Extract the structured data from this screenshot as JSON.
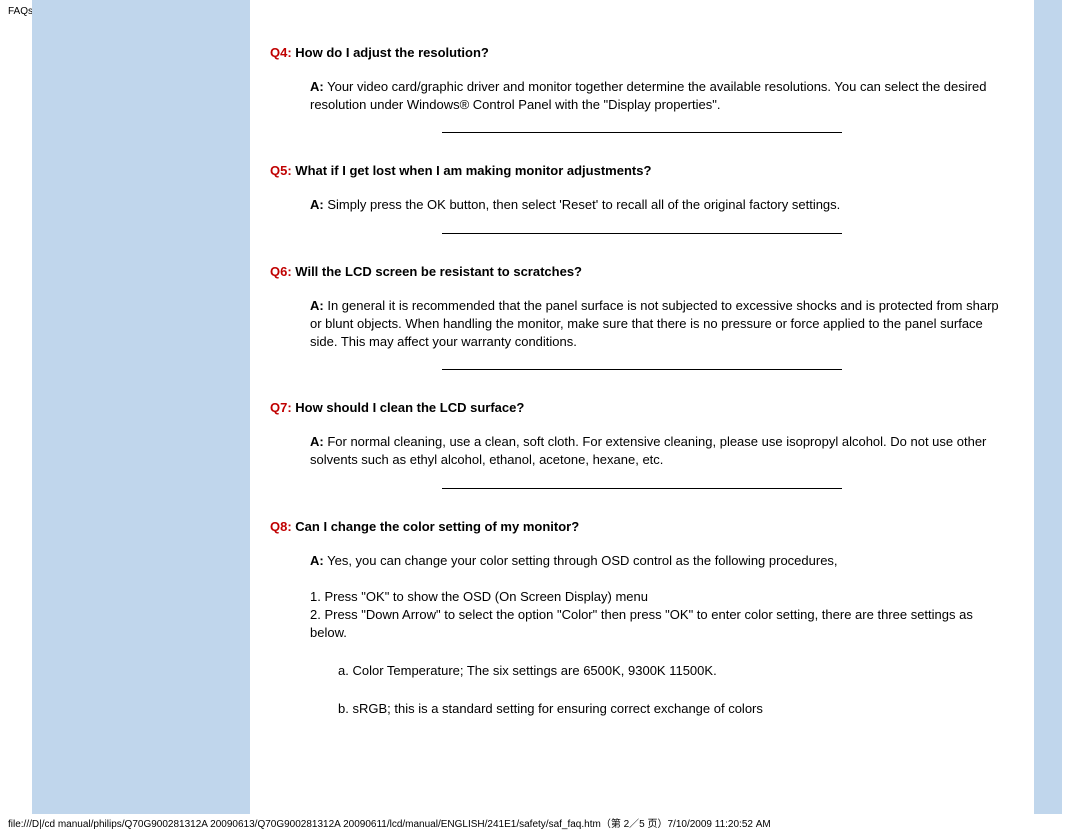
{
  "header": {
    "title": "FAQs (Frequently Asked Questions)"
  },
  "faqs": {
    "q4": {
      "label": "Q4:",
      "question": "How do I adjust the resolution?",
      "a_label": "A:",
      "answer": "Your video card/graphic driver and monitor together determine the available resolutions. You can select the desired resolution under Windows® Control Panel with the \"Display properties\"."
    },
    "q5": {
      "label": "Q5:",
      "question": "What if I get lost when I am making monitor adjustments?",
      "a_label": "A:",
      "answer": "Simply press the OK button, then select 'Reset' to recall all of the original factory settings."
    },
    "q6": {
      "label": "Q6:",
      "question": "Will the LCD screen be resistant to scratches?",
      "a_label": "A:",
      "answer": "In general it is recommended that the panel surface is not subjected to excessive shocks and is protected from sharp or blunt objects. When handling the monitor, make sure that there is no pressure or force applied to the panel surface side. This may affect your warranty conditions."
    },
    "q7": {
      "label": "Q7:",
      "question": "How should I clean the LCD surface?",
      "a_label": "A:",
      "answer": "For normal cleaning, use a clean, soft cloth. For extensive cleaning, please use isopropyl alcohol. Do not use other solvents such as ethyl alcohol, ethanol, acetone, hexane, etc."
    },
    "q8": {
      "label": "Q8:",
      "question": "Can I change the color setting of my monitor?",
      "a_label": "A:",
      "answer": "Yes, you can change your color setting through OSD control as the following procedures,",
      "step1": "1. Press \"OK\" to show the OSD (On Screen Display) menu",
      "step2": "2. Press \"Down Arrow\" to select the option \"Color\" then press \"OK\" to enter color setting, there are three settings as below.",
      "item_a": "a. Color Temperature; The six settings are  6500K, 9300K 11500K.",
      "item_b": "b. sRGB; this is a standard setting for ensuring correct exchange of colors"
    }
  },
  "footer": {
    "text": "file:///D|/cd manual/philips/Q70G900281312A 20090613/Q70G900281312A 20090611/lcd/manual/ENGLISH/241E1/safety/saf_faq.htm（第 2／5 页）7/10/2009 11:20:52 AM"
  }
}
